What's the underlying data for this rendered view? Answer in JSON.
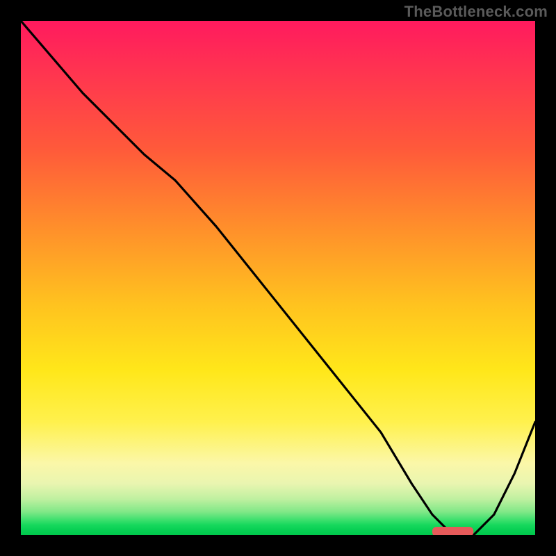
{
  "watermark": "TheBottleneck.com",
  "chart_data": {
    "type": "line",
    "title": "",
    "xlabel": "",
    "ylabel": "",
    "xlim": [
      0,
      100
    ],
    "ylim": [
      0,
      100
    ],
    "grid": false,
    "legend": null,
    "series": [
      {
        "name": "bottleneck-curve",
        "x": [
          0,
          6,
          12,
          18,
          24,
          30,
          38,
          46,
          54,
          62,
          70,
          76,
          80,
          84,
          88,
          92,
          96,
          100
        ],
        "y": [
          100,
          93,
          86,
          80,
          74,
          69,
          60,
          50,
          40,
          30,
          20,
          10,
          4,
          0,
          0,
          4,
          12,
          22
        ]
      }
    ],
    "marker": {
      "name": "optimal-zone",
      "x_start": 80,
      "x_end": 88,
      "y": 0,
      "color": "#e65a5a"
    },
    "background_gradient": {
      "stops": [
        {
          "pos": 0.0,
          "color": "#ff1a5e"
        },
        {
          "pos": 0.25,
          "color": "#ff5a3a"
        },
        {
          "pos": 0.55,
          "color": "#ffc21f"
        },
        {
          "pos": 0.78,
          "color": "#fff14d"
        },
        {
          "pos": 0.93,
          "color": "#bff0a0"
        },
        {
          "pos": 1.0,
          "color": "#00c84c"
        }
      ]
    }
  }
}
